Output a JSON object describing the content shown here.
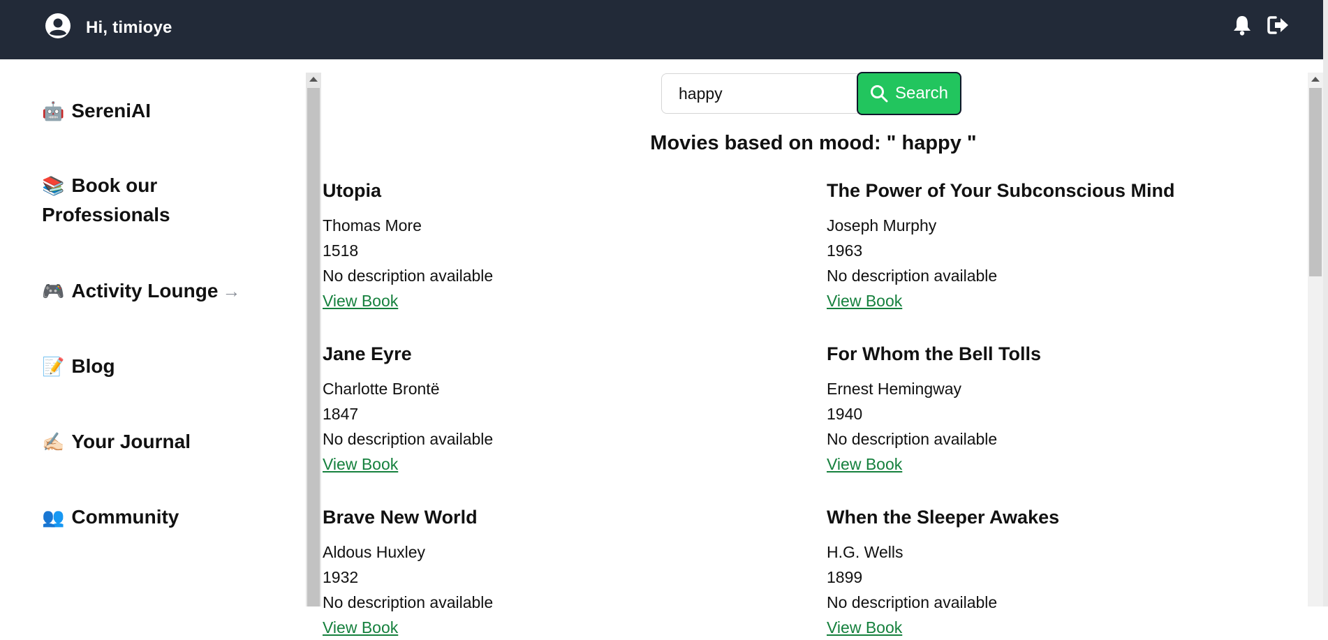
{
  "header": {
    "greeting": "Hi, timioye",
    "icons": [
      "user-avatar-icon",
      "bell-icon",
      "logout-icon"
    ],
    "background": "#222a38"
  },
  "sidebar": {
    "items": [
      {
        "emoji": "🤖",
        "label": "SereniAI"
      },
      {
        "emoji": "📚",
        "label": "Book our Professionals"
      },
      {
        "emoji": "🎮",
        "label": "Activity Lounge",
        "arrow": "→"
      },
      {
        "emoji": "📝",
        "label": "Blog"
      },
      {
        "emoji": "✍🏻",
        "label": "Your Journal"
      },
      {
        "emoji": "👥",
        "label": "Community"
      }
    ]
  },
  "search": {
    "value": "happy",
    "button_label": "Search",
    "button_color": "#22c55e"
  },
  "results": {
    "title": "Movies based on mood: \" happy \"",
    "link_label": "View Book",
    "link_color": "#15803d",
    "books": [
      {
        "title": "Utopia",
        "author": "Thomas More",
        "year": "1518",
        "description": "No description available"
      },
      {
        "title": "The Power of Your Subconscious Mind",
        "author": "Joseph Murphy",
        "year": "1963",
        "description": "No description available"
      },
      {
        "title": "Jane Eyre",
        "author": "Charlotte Brontë",
        "year": "1847",
        "description": "No description available"
      },
      {
        "title": "For Whom the Bell Tolls",
        "author": "Ernest Hemingway",
        "year": "1940",
        "description": "No description available"
      },
      {
        "title": "Brave New World",
        "author": "Aldous Huxley",
        "year": "1932",
        "description": "No description available"
      },
      {
        "title": "When the Sleeper Awakes",
        "author": "H.G. Wells",
        "year": "1899",
        "description": "No description available"
      }
    ]
  }
}
